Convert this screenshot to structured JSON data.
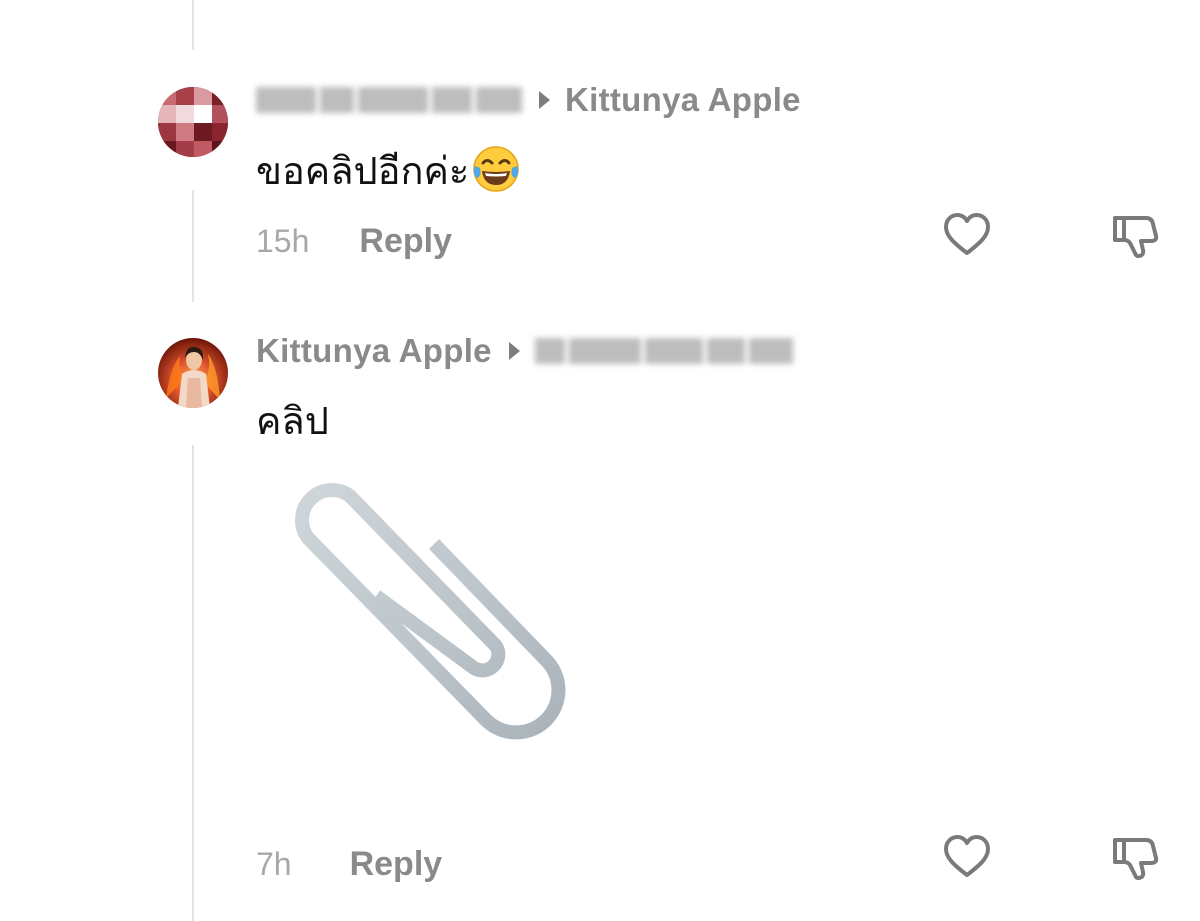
{
  "comments": [
    {
      "username": "",
      "reply_to": "Kittunya Apple",
      "text": "ขอคลิปอีกค่ะ",
      "emoji": "face-with-tears-of-joy",
      "time": "15h",
      "reply_label": "Reply"
    },
    {
      "username": "Kittunya Apple",
      "reply_to": "",
      "text": "คลิป",
      "attachment": "paperclip",
      "time": "7h",
      "reply_label": "Reply"
    }
  ],
  "colors": {
    "username": "#8a8a8a",
    "time": "#a8a8a8",
    "text": "#111111",
    "icon": "#7a7a7a",
    "thread_line": "#e3e3e3"
  },
  "icons": [
    "heart-icon",
    "dislike-icon",
    "paperclip-icon",
    "play-arrow-icon"
  ]
}
